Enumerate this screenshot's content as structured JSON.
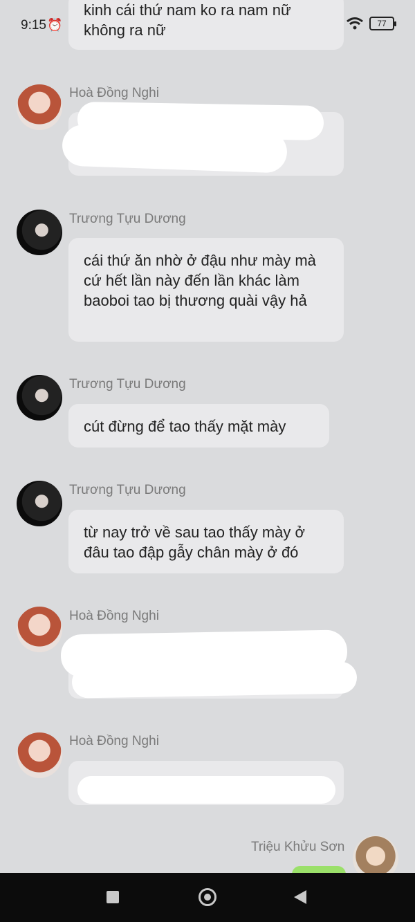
{
  "status": {
    "time": "9:15",
    "battery": "77",
    "icons": [
      "alarm-icon",
      "app-notification-icon",
      "chrome-icon",
      "signal-icon",
      "wifi-icon",
      "battery-icon"
    ]
  },
  "messages": [
    {
      "sender": "",
      "text": "kinh cái thứ nam ko ra nam nữ không ra nữ"
    },
    {
      "sender": "Hoà Đồng Nghi",
      "text": ""
    },
    {
      "sender": "Trương Tựu Dương",
      "text": "cái thứ ăn nhờ ở đậu như mày mà cứ hết lần này đến lần khác làm baoboi tao bị thương quài vậy hả"
    },
    {
      "sender": "Trương Tựu Dương",
      "text": "cút đừng để tao thấy mặt mày"
    },
    {
      "sender": "Trương Tựu Dương",
      "text": "từ nay trở về sau tao thấy mày ở đâu tao đập gẫy chân mày ở đó"
    },
    {
      "sender": "Hoà Đồng Nghi",
      "text": ""
    },
    {
      "sender": "Hoà Đồng Nghi",
      "text": ""
    },
    {
      "sender": "Triệu Khửu Sơn",
      "text": ""
    }
  ],
  "colors": {
    "background": "#dadbdd",
    "bubble": "#e9e9eb",
    "sent_bubble": "#9be06a",
    "nav": "#0c0c0c"
  },
  "nav": {
    "icons": [
      "recent-apps-icon",
      "home-icon",
      "back-icon"
    ]
  }
}
